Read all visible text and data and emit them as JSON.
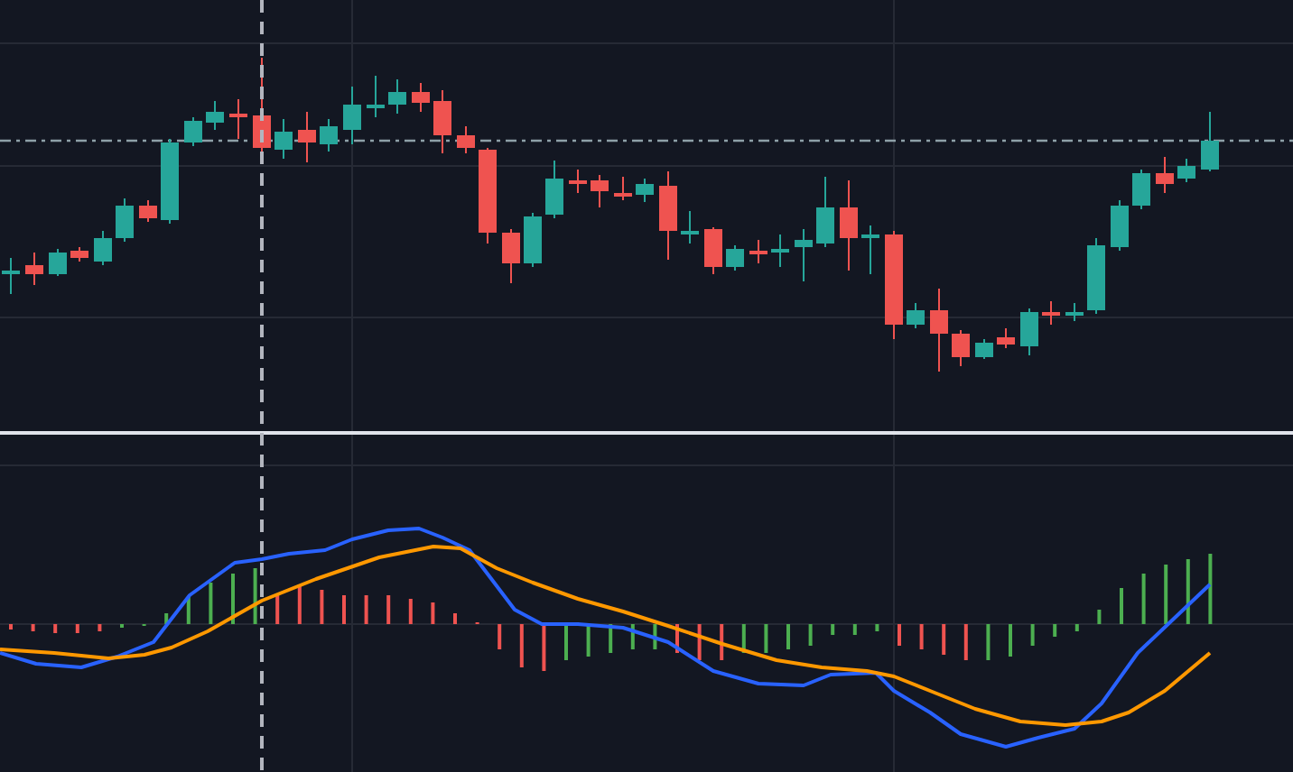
{
  "panes": [
    {
      "kind": "price"
    },
    {
      "kind": "indicator",
      "series": [
        {
          "kind": "macd",
          "color": "#2962ff"
        },
        {
          "kind": "signal",
          "color": "#ff9800"
        }
      ]
    }
  ],
  "crosshair": {
    "visible": true
  }
}
